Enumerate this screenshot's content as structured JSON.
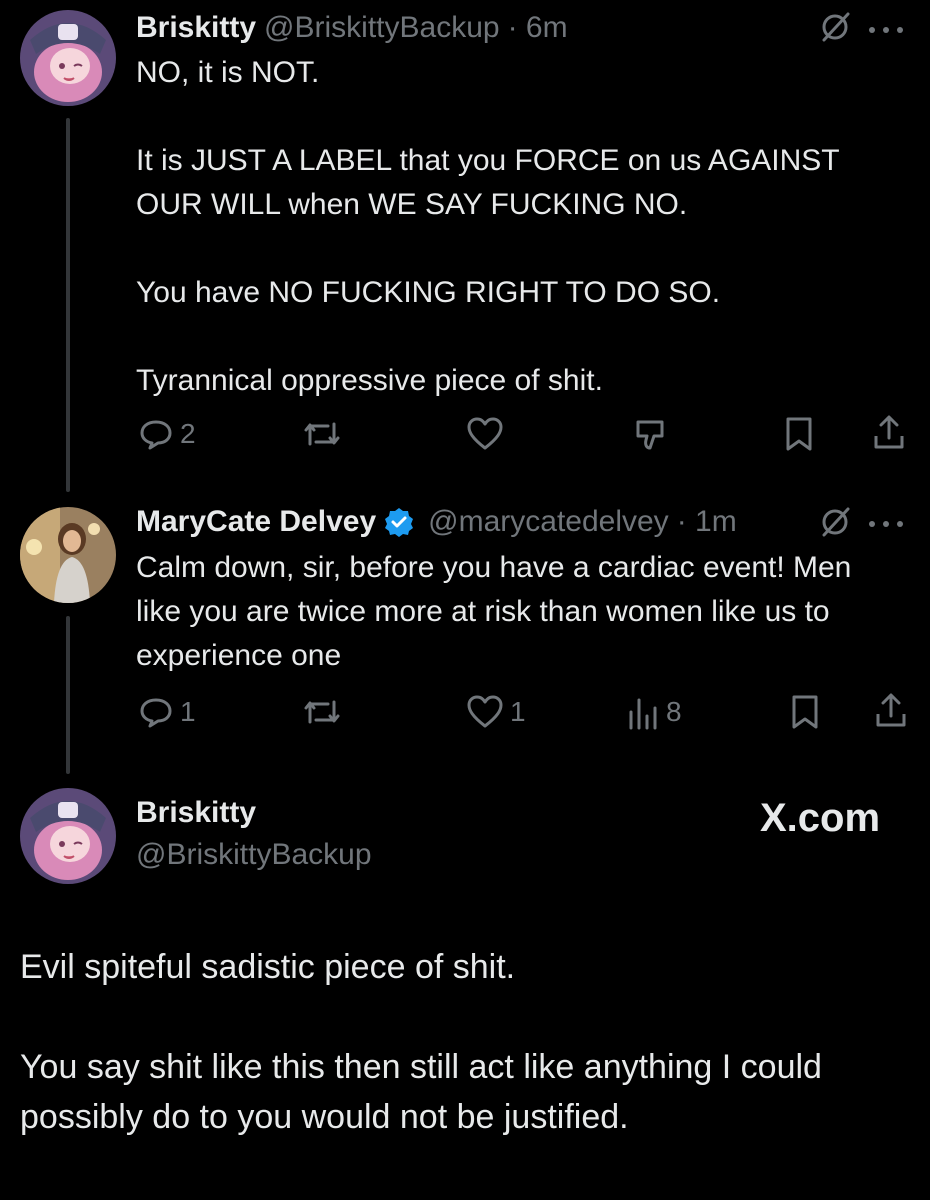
{
  "tweets": [
    {
      "name": "Briskitty",
      "handle": "@BriskittyBackup",
      "time": "· 6m",
      "paragraphs": [
        "NO, it is NOT.",
        "It is JUST A LABEL that you FORCE on us AGAINST OUR WILL when WE SAY FUCKING NO.",
        "You have NO FUCKING RIGHT TO DO SO.",
        "Tyrannical oppressive piece of shit."
      ],
      "actions": {
        "replies": "2",
        "reposts": "",
        "likes": "",
        "views": ""
      }
    },
    {
      "name": "MaryCate Delvey",
      "handle": "@marycatedelvey",
      "time": "· 1m",
      "verified": true,
      "text": "Calm down, sir, before you have a cardiac event! Men like you are twice more at risk than women like us to experience one",
      "actions": {
        "replies": "1",
        "reposts": "",
        "likes": "1",
        "views": "8"
      }
    }
  ],
  "quote": {
    "name": "Briskitty",
    "handle": "@BriskittyBackup",
    "brand": "X.com",
    "paragraphs": [
      "Evil spiteful sadistic piece of shit.",
      "You say shit like this then still act like anything I could possibly do to you would not be justified."
    ]
  },
  "icons": {
    "reply": "reply-icon",
    "repost": "repost-icon",
    "like": "heart-icon",
    "views": "views-icon",
    "bookmark": "bookmark-icon",
    "share": "share-icon",
    "grok": "grok-icon",
    "more": "more-icon",
    "dislike": "dislike-icon",
    "verified": "verified-badge-icon"
  },
  "colors": {
    "background": "#000000",
    "text": "#e7e9ea",
    "muted": "#71767b",
    "verified": "#1d9bf0"
  }
}
